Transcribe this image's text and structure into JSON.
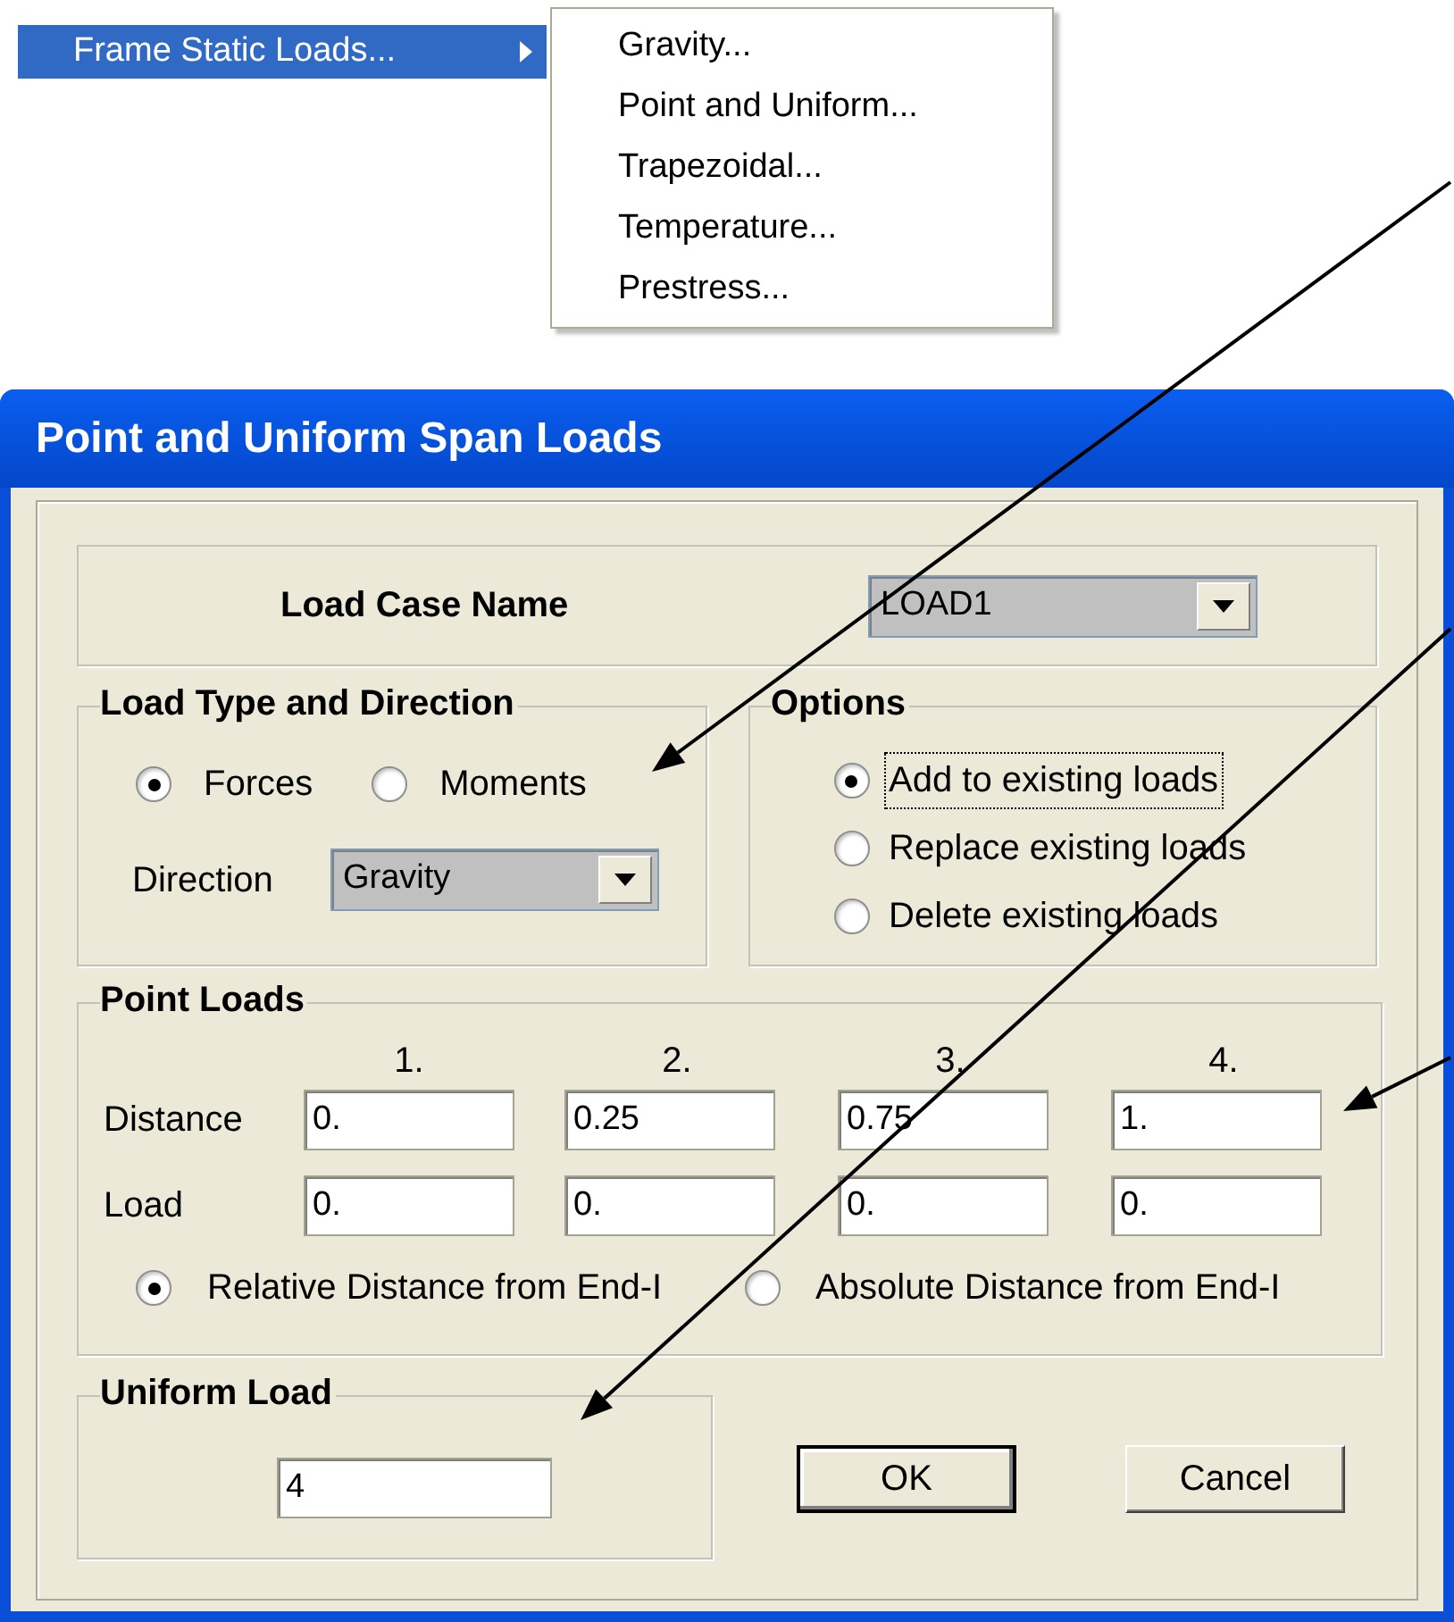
{
  "menu": {
    "item": {
      "label": "Frame Static Loads...",
      "selected": true
    },
    "submenu": [
      {
        "label": "Gravity..."
      },
      {
        "label": "Point and Uniform..."
      },
      {
        "label": "Trapezoidal..."
      },
      {
        "label": "Temperature..."
      },
      {
        "label": "Prestress..."
      }
    ]
  },
  "dialog": {
    "title": "Point and Uniform Span Loads",
    "load_case": {
      "label": "Load Case Name",
      "value": "LOAD1"
    },
    "load_type": {
      "title": "Load Type and Direction",
      "options": [
        {
          "label": "Forces",
          "selected": true
        },
        {
          "label": "Moments",
          "selected": false
        }
      ],
      "direction": {
        "label": "Direction",
        "value": "Gravity"
      }
    },
    "options": {
      "title": "Options",
      "items": [
        {
          "label": "Add to existing loads",
          "selected": true,
          "focused": true
        },
        {
          "label": "Replace existing loads",
          "selected": false,
          "focused": false
        },
        {
          "label": "Delete existing loads",
          "selected": false,
          "focused": false
        }
      ]
    },
    "point_loads": {
      "title": "Point Loads",
      "columns": [
        "1.",
        "2.",
        "3.",
        "4."
      ],
      "rows": [
        {
          "label": "Distance",
          "values": [
            "0.",
            "0.25",
            "0.75",
            "1."
          ]
        },
        {
          "label": "Load",
          "values": [
            "0.",
            "0.",
            "0.",
            "0."
          ]
        }
      ],
      "distance_modes": [
        {
          "label": "Relative Distance from End-I",
          "selected": true
        },
        {
          "label": "Absolute Distance from End-I",
          "selected": false
        }
      ]
    },
    "uniform_load": {
      "title": "Uniform Load",
      "value": "4"
    },
    "buttons": [
      {
        "label": "OK",
        "default": true
      },
      {
        "label": "Cancel",
        "default": false
      }
    ]
  }
}
